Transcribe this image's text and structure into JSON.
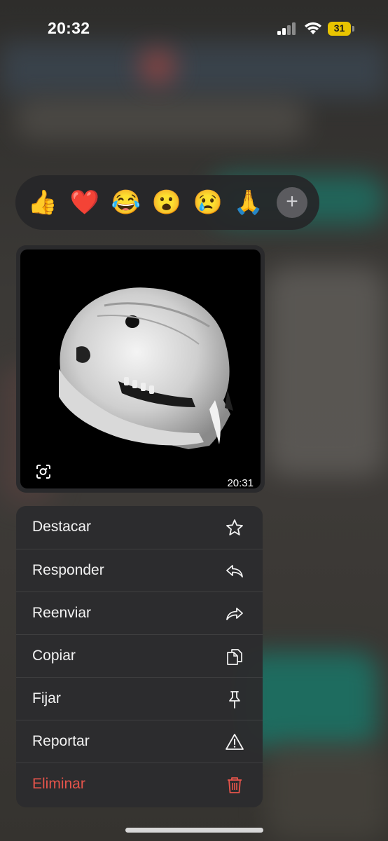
{
  "status_bar": {
    "time": "20:32",
    "battery": "31"
  },
  "reactions": {
    "emojis": [
      "👍",
      "❤️",
      "😂",
      "😮",
      "😢",
      "🙏"
    ],
    "more": "+"
  },
  "message": {
    "timestamp": "20:31"
  },
  "menu": {
    "items": [
      {
        "label": "Destacar",
        "icon": "star-icon"
      },
      {
        "label": "Responder",
        "icon": "reply-icon"
      },
      {
        "label": "Reenviar",
        "icon": "forward-icon"
      },
      {
        "label": "Copiar",
        "icon": "copy-icon"
      },
      {
        "label": "Fijar",
        "icon": "pin-icon"
      },
      {
        "label": "Reportar",
        "icon": "warning-icon"
      },
      {
        "label": "Eliminar",
        "icon": "trash-icon"
      }
    ]
  },
  "colors": {
    "danger": "#e5544b",
    "battery": "#e9c400",
    "menu_bg": "#2c2c2e"
  }
}
